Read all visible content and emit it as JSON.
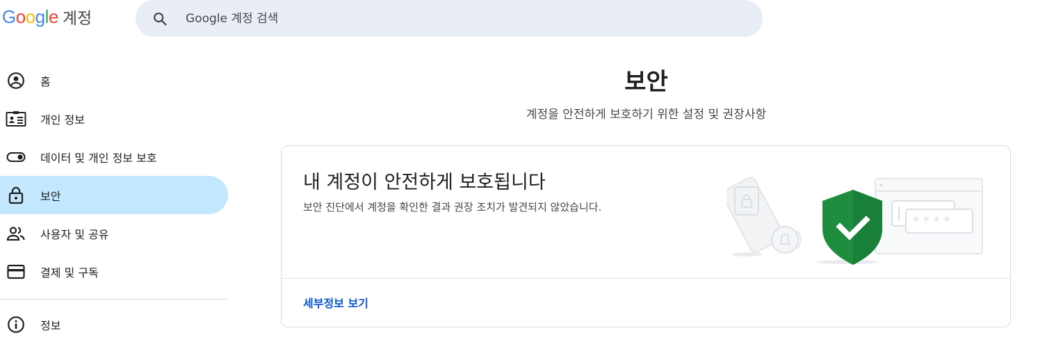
{
  "header": {
    "logo_letters": [
      "G",
      "o",
      "o",
      "g",
      "l",
      "e"
    ],
    "product_name": "계정",
    "search_placeholder": "Google 계정 검색"
  },
  "sidebar": {
    "items": [
      {
        "label": "홈",
        "icon": "account-circle-icon",
        "active": false
      },
      {
        "label": "개인 정보",
        "icon": "id-card-icon",
        "active": false
      },
      {
        "label": "데이터 및 개인 정보 보호",
        "icon": "toggle-icon",
        "active": false
      },
      {
        "label": "보안",
        "icon": "lock-icon",
        "active": true
      },
      {
        "label": "사용자 및 공유",
        "icon": "people-icon",
        "active": false
      },
      {
        "label": "결제 및 구독",
        "icon": "credit-card-icon",
        "active": false
      }
    ],
    "secondary_items": [
      {
        "label": "정보",
        "icon": "info-icon",
        "active": false
      }
    ]
  },
  "main": {
    "title": "보안",
    "subtitle": "계정을 안전하게 보호하기 위한 설정 및 권장사항",
    "card": {
      "title": "내 계정이 안전하게 보호됩니다",
      "description": "보안 진단에서 계정을 확인한 결과 권장 조치가 발견되지 않았습니다.",
      "link": "세부정보 보기",
      "password_mask": "* * * *"
    }
  },
  "colors": {
    "active_nav_bg": "#c2e7ff",
    "search_bg": "#e9eef6",
    "link": "#0b57d0",
    "shield_green": "#1e8e3e",
    "google_blue": "#4285f4",
    "google_red": "#ea4335",
    "google_yellow": "#fbbc05",
    "google_green": "#34a853"
  }
}
